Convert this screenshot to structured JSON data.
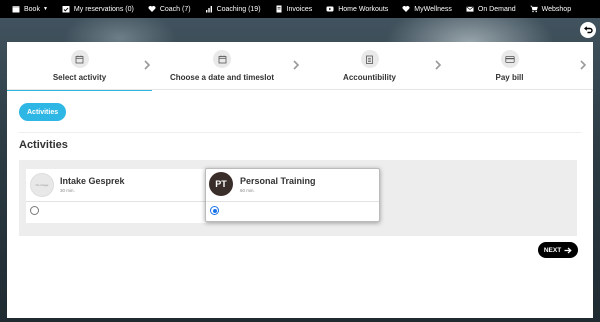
{
  "nav": {
    "items": [
      {
        "label": "Book",
        "icon": "calendar-icon",
        "has_caret": true
      },
      {
        "label": "My reservations (0)",
        "icon": "calendar-check-icon"
      },
      {
        "label": "Coach (7)",
        "icon": "heart-icon"
      },
      {
        "label": "Coaching (19)",
        "icon": "bar-chart-icon"
      },
      {
        "label": "Invoices",
        "icon": "document-icon"
      },
      {
        "label": "Home Workouts",
        "icon": "play-icon"
      },
      {
        "label": "MyWellness",
        "icon": "heart-icon"
      },
      {
        "label": "On Demand",
        "icon": "envelope-icon"
      },
      {
        "label": "Webshop",
        "icon": "cart-icon"
      }
    ]
  },
  "steps": [
    {
      "label": "Select activity",
      "icon": "calendar-icon",
      "active": true
    },
    {
      "label": "Choose a date and timeslot",
      "icon": "calendar-icon",
      "active": false
    },
    {
      "label": "Accountibility",
      "icon": "clipboard-icon",
      "active": false
    },
    {
      "label": "Pay bill",
      "icon": "credit-card-icon",
      "active": false
    }
  ],
  "filter": {
    "activities_label": "Activities"
  },
  "section": {
    "title": "Activities"
  },
  "activities": [
    {
      "name": "Intake Gesprek",
      "duration": "30 min.",
      "avatar_text": "No image",
      "selected": false
    },
    {
      "name": "Personal Training",
      "duration": "60 min.",
      "avatar_text": "PT",
      "selected": true
    }
  ],
  "footer": {
    "next_label": "NEXT"
  },
  "colors": {
    "accent": "#2eb6e5",
    "nav_bg": "#000000",
    "radio_selected": "#1a73e8"
  }
}
